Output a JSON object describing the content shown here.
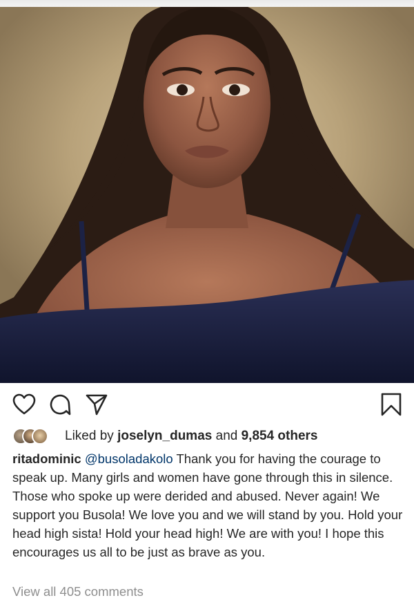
{
  "post": {
    "actions": {
      "like_icon": "heart-outline-icon",
      "comment_icon": "comment-bubble-icon",
      "share_icon": "paper-plane-icon",
      "save_icon": "bookmark-icon"
    },
    "likes": {
      "prefix": "Liked by",
      "user": "joselyn_dumas",
      "joiner": "and",
      "count": "9,854 others"
    },
    "caption": {
      "username": "ritadominic",
      "mention": "@busoladakolo",
      "text": " Thank you for having the courage to speak up. Many girls and women have gone through this in silence. Those who spoke up were derided and abused. Never again! We support you Busola! We love you and we will stand by you. Hold your head high sista! Hold your head high! We are with you! I hope this encourages us all to be just as brave as you."
    },
    "comments_link": "View all 405 comments"
  },
  "colors": {
    "text": "#262626",
    "mention": "#003569",
    "muted": "#8e8e8e"
  }
}
